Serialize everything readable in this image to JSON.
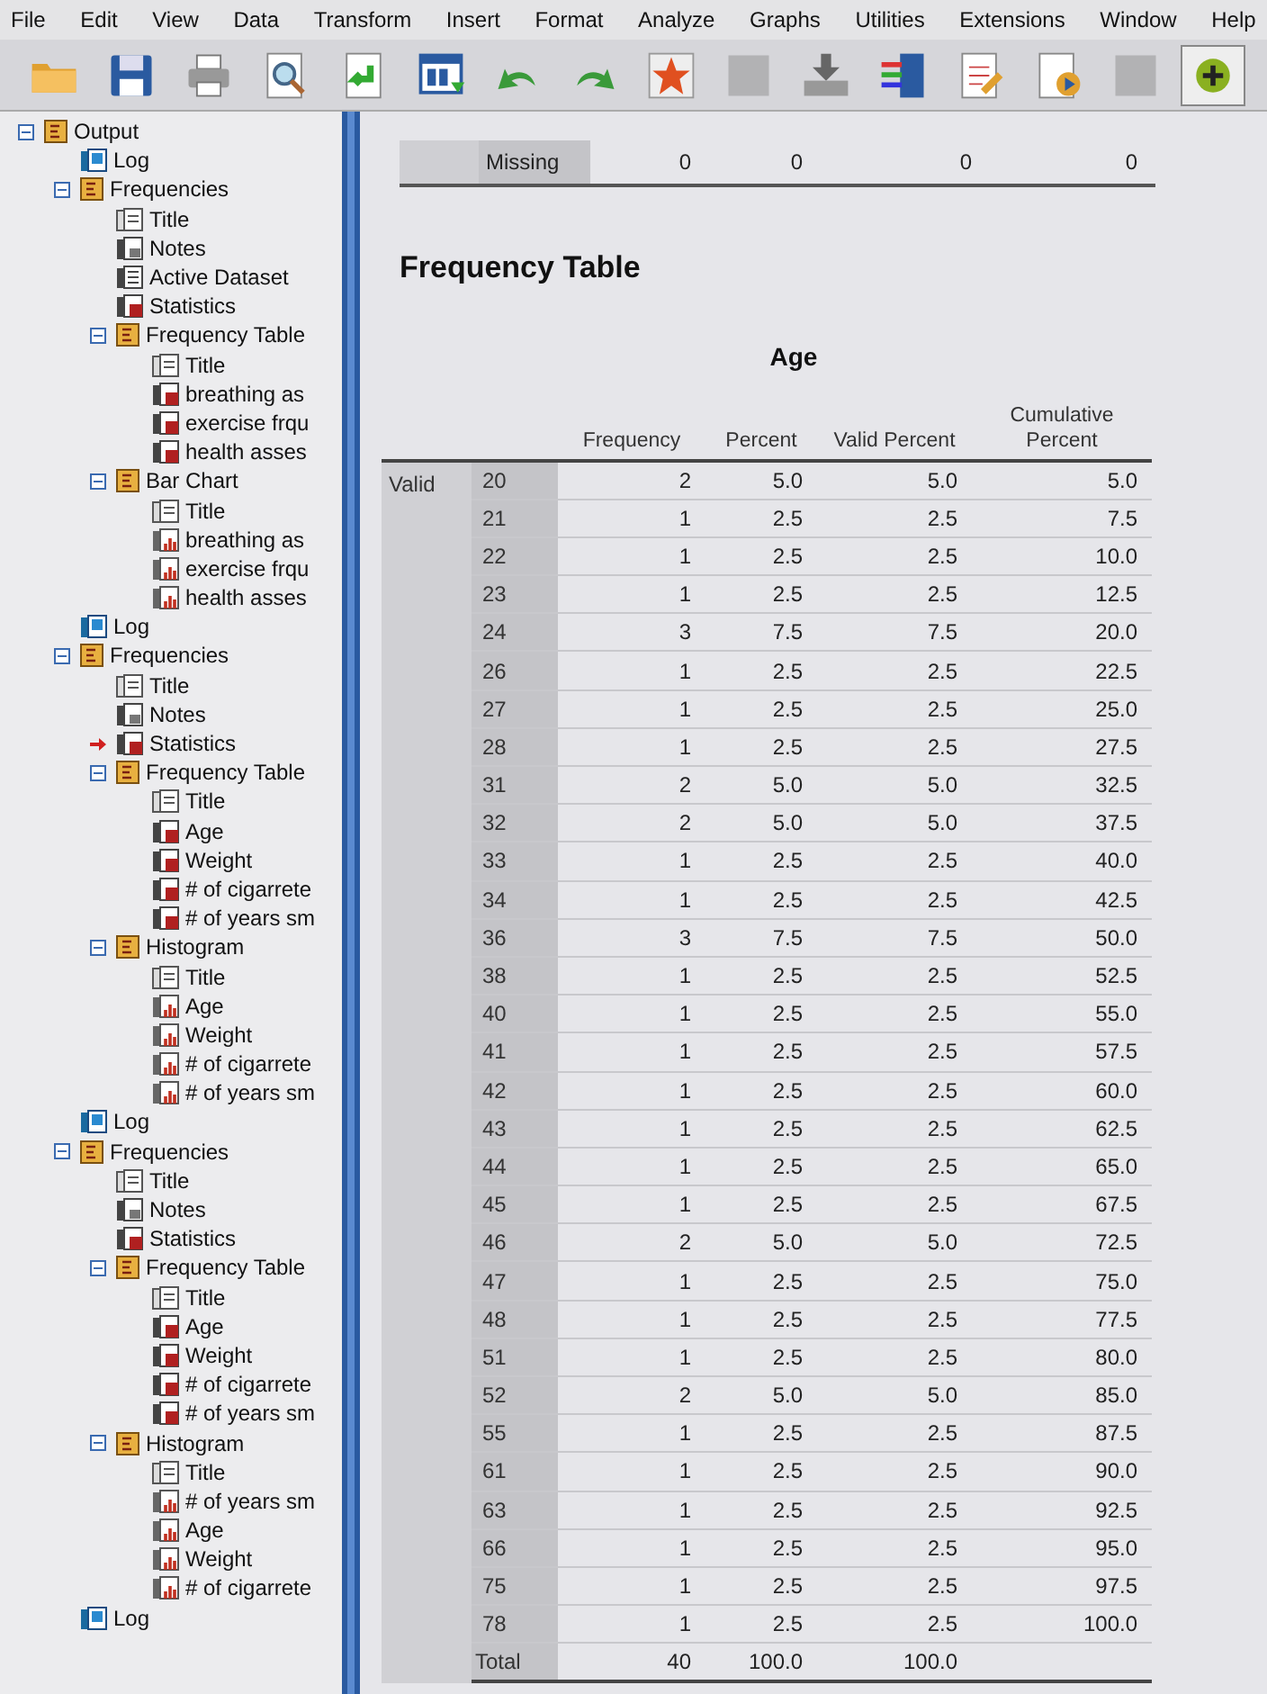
{
  "menu": [
    "File",
    "Edit",
    "View",
    "Data",
    "Transform",
    "Insert",
    "Format",
    "Analyze",
    "Graphs",
    "Utilities",
    "Extensions",
    "Window",
    "Help"
  ],
  "toolbar": [
    {
      "kind": "folder",
      "disabled": false
    },
    {
      "kind": "save",
      "disabled": false
    },
    {
      "kind": "print",
      "disabled": false
    },
    {
      "kind": "preview",
      "disabled": false
    },
    {
      "kind": "export",
      "disabled": false
    },
    {
      "kind": "dialog",
      "disabled": false
    },
    {
      "kind": "undo",
      "disabled": false
    },
    {
      "kind": "redo",
      "disabled": false
    },
    {
      "kind": "star",
      "disabled": false
    },
    {
      "kind": "grid",
      "disabled": true
    },
    {
      "kind": "download",
      "disabled": false
    },
    {
      "kind": "list",
      "disabled": false
    },
    {
      "kind": "edit",
      "disabled": false
    },
    {
      "kind": "script",
      "disabled": false
    },
    {
      "kind": "grid",
      "disabled": true
    },
    {
      "kind": "plus",
      "disabled": false
    }
  ],
  "outline": [
    {
      "label": "Output",
      "kind": "book",
      "expanded": true,
      "current": false,
      "children": [
        {
          "label": "Log",
          "kind": "log",
          "current": false
        },
        {
          "label": "Frequencies",
          "kind": "book",
          "expanded": true,
          "current": false,
          "children": [
            {
              "label": "Title",
              "kind": "title",
              "current": false
            },
            {
              "label": "Notes",
              "kind": "notes",
              "current": false
            },
            {
              "label": "Active Dataset",
              "kind": "dataset",
              "current": false
            },
            {
              "label": "Statistics",
              "kind": "table",
              "current": false
            },
            {
              "label": "Frequency Table",
              "kind": "book",
              "expanded": true,
              "current": false,
              "children": [
                {
                  "label": "Title",
                  "kind": "title",
                  "current": false
                },
                {
                  "label": "breathing as",
                  "kind": "table",
                  "current": false
                },
                {
                  "label": "exercise frqu",
                  "kind": "table",
                  "current": false
                },
                {
                  "label": "health asses",
                  "kind": "table",
                  "current": false
                }
              ]
            },
            {
              "label": "Bar Chart",
              "kind": "book",
              "expanded": true,
              "current": false,
              "children": [
                {
                  "label": "Title",
                  "kind": "title",
                  "current": false
                },
                {
                  "label": "breathing as",
                  "kind": "chart",
                  "current": false
                },
                {
                  "label": "exercise frqu",
                  "kind": "chart",
                  "current": false
                },
                {
                  "label": "health asses",
                  "kind": "chart",
                  "current": false
                }
              ]
            }
          ]
        },
        {
          "label": "Log",
          "kind": "log",
          "current": false
        },
        {
          "label": "Frequencies",
          "kind": "book",
          "expanded": true,
          "current": false,
          "children": [
            {
              "label": "Title",
              "kind": "title",
              "current": false
            },
            {
              "label": "Notes",
              "kind": "notes",
              "current": false
            },
            {
              "label": "Statistics",
              "kind": "table",
              "current": true
            },
            {
              "label": "Frequency Table",
              "kind": "book",
              "expanded": true,
              "current": false,
              "children": [
                {
                  "label": "Title",
                  "kind": "title",
                  "current": false
                },
                {
                  "label": "Age",
                  "kind": "table",
                  "current": false
                },
                {
                  "label": "Weight",
                  "kind": "table",
                  "current": false
                },
                {
                  "label": "# of cigarrete",
                  "kind": "table",
                  "current": false
                },
                {
                  "label": "# of years sm",
                  "kind": "table",
                  "current": false
                }
              ]
            },
            {
              "label": "Histogram",
              "kind": "book",
              "expanded": true,
              "current": false,
              "children": [
                {
                  "label": "Title",
                  "kind": "title",
                  "current": false
                },
                {
                  "label": "Age",
                  "kind": "chart",
                  "current": false
                },
                {
                  "label": "Weight",
                  "kind": "chart",
                  "current": false
                },
                {
                  "label": "# of cigarrete",
                  "kind": "chart",
                  "current": false
                },
                {
                  "label": "# of years sm",
                  "kind": "chart",
                  "current": false
                }
              ]
            }
          ]
        },
        {
          "label": "Log",
          "kind": "log",
          "current": false
        },
        {
          "label": "Frequencies",
          "kind": "book",
          "expanded": true,
          "current": false,
          "children": [
            {
              "label": "Title",
              "kind": "title",
              "current": false
            },
            {
              "label": "Notes",
              "kind": "notes",
              "current": false
            },
            {
              "label": "Statistics",
              "kind": "table",
              "current": false
            },
            {
              "label": "Frequency Table",
              "kind": "book",
              "expanded": true,
              "current": false,
              "children": [
                {
                  "label": "Title",
                  "kind": "title",
                  "current": false
                },
                {
                  "label": "Age",
                  "kind": "table",
                  "current": false
                },
                {
                  "label": "Weight",
                  "kind": "table",
                  "current": false
                },
                {
                  "label": "# of cigarrete",
                  "kind": "table",
                  "current": false
                },
                {
                  "label": "# of years sm",
                  "kind": "table",
                  "current": false
                }
              ]
            },
            {
              "label": "Histogram",
              "kind": "book",
              "expanded": true,
              "current": false,
              "children": [
                {
                  "label": "Title",
                  "kind": "title",
                  "current": false
                },
                {
                  "label": "# of years sm",
                  "kind": "chart",
                  "current": false
                },
                {
                  "label": "Age",
                  "kind": "chart",
                  "current": false
                },
                {
                  "label": "Weight",
                  "kind": "chart",
                  "current": false
                },
                {
                  "label": "# of cigarrete",
                  "kind": "chart",
                  "current": false
                }
              ]
            }
          ]
        },
        {
          "label": "Log",
          "kind": "log",
          "current": false
        }
      ]
    }
  ],
  "statistics_table": {
    "row_label": "Missing",
    "values": [
      "0",
      "0",
      "0",
      "0"
    ]
  },
  "heading": "Frequency Table",
  "frequency_table": {
    "title": "Age",
    "columns": [
      "Frequency",
      "Percent",
      "Valid Percent",
      "Cumulative Percent"
    ],
    "group_label": "Valid",
    "rows": [
      {
        "label": "20",
        "values": [
          "2",
          "5.0",
          "5.0",
          "5.0"
        ]
      },
      {
        "label": "21",
        "values": [
          "1",
          "2.5",
          "2.5",
          "7.5"
        ]
      },
      {
        "label": "22",
        "values": [
          "1",
          "2.5",
          "2.5",
          "10.0"
        ]
      },
      {
        "label": "23",
        "values": [
          "1",
          "2.5",
          "2.5",
          "12.5"
        ]
      },
      {
        "label": "24",
        "values": [
          "3",
          "7.5",
          "7.5",
          "20.0"
        ]
      },
      {
        "label": "26",
        "values": [
          "1",
          "2.5",
          "2.5",
          "22.5"
        ]
      },
      {
        "label": "27",
        "values": [
          "1",
          "2.5",
          "2.5",
          "25.0"
        ]
      },
      {
        "label": "28",
        "values": [
          "1",
          "2.5",
          "2.5",
          "27.5"
        ]
      },
      {
        "label": "31",
        "values": [
          "2",
          "5.0",
          "5.0",
          "32.5"
        ]
      },
      {
        "label": "32",
        "values": [
          "2",
          "5.0",
          "5.0",
          "37.5"
        ]
      },
      {
        "label": "33",
        "values": [
          "1",
          "2.5",
          "2.5",
          "40.0"
        ]
      },
      {
        "label": "34",
        "values": [
          "1",
          "2.5",
          "2.5",
          "42.5"
        ]
      },
      {
        "label": "36",
        "values": [
          "3",
          "7.5",
          "7.5",
          "50.0"
        ]
      },
      {
        "label": "38",
        "values": [
          "1",
          "2.5",
          "2.5",
          "52.5"
        ]
      },
      {
        "label": "40",
        "values": [
          "1",
          "2.5",
          "2.5",
          "55.0"
        ]
      },
      {
        "label": "41",
        "values": [
          "1",
          "2.5",
          "2.5",
          "57.5"
        ]
      },
      {
        "label": "42",
        "values": [
          "1",
          "2.5",
          "2.5",
          "60.0"
        ]
      },
      {
        "label": "43",
        "values": [
          "1",
          "2.5",
          "2.5",
          "62.5"
        ]
      },
      {
        "label": "44",
        "values": [
          "1",
          "2.5",
          "2.5",
          "65.0"
        ]
      },
      {
        "label": "45",
        "values": [
          "1",
          "2.5",
          "2.5",
          "67.5"
        ]
      },
      {
        "label": "46",
        "values": [
          "2",
          "5.0",
          "5.0",
          "72.5"
        ]
      },
      {
        "label": "47",
        "values": [
          "1",
          "2.5",
          "2.5",
          "75.0"
        ]
      },
      {
        "label": "48",
        "values": [
          "1",
          "2.5",
          "2.5",
          "77.5"
        ]
      },
      {
        "label": "51",
        "values": [
          "1",
          "2.5",
          "2.5",
          "80.0"
        ]
      },
      {
        "label": "52",
        "values": [
          "2",
          "5.0",
          "5.0",
          "85.0"
        ]
      },
      {
        "label": "55",
        "values": [
          "1",
          "2.5",
          "2.5",
          "87.5"
        ]
      },
      {
        "label": "61",
        "values": [
          "1",
          "2.5",
          "2.5",
          "90.0"
        ]
      },
      {
        "label": "63",
        "values": [
          "1",
          "2.5",
          "2.5",
          "92.5"
        ]
      },
      {
        "label": "66",
        "values": [
          "1",
          "2.5",
          "2.5",
          "95.0"
        ]
      },
      {
        "label": "75",
        "values": [
          "1",
          "2.5",
          "2.5",
          "97.5"
        ]
      },
      {
        "label": "78",
        "values": [
          "1",
          "2.5",
          "2.5",
          "100.0"
        ]
      }
    ],
    "total": {
      "label": "Total",
      "values": [
        "40",
        "100.0",
        "100.0"
      ]
    }
  }
}
